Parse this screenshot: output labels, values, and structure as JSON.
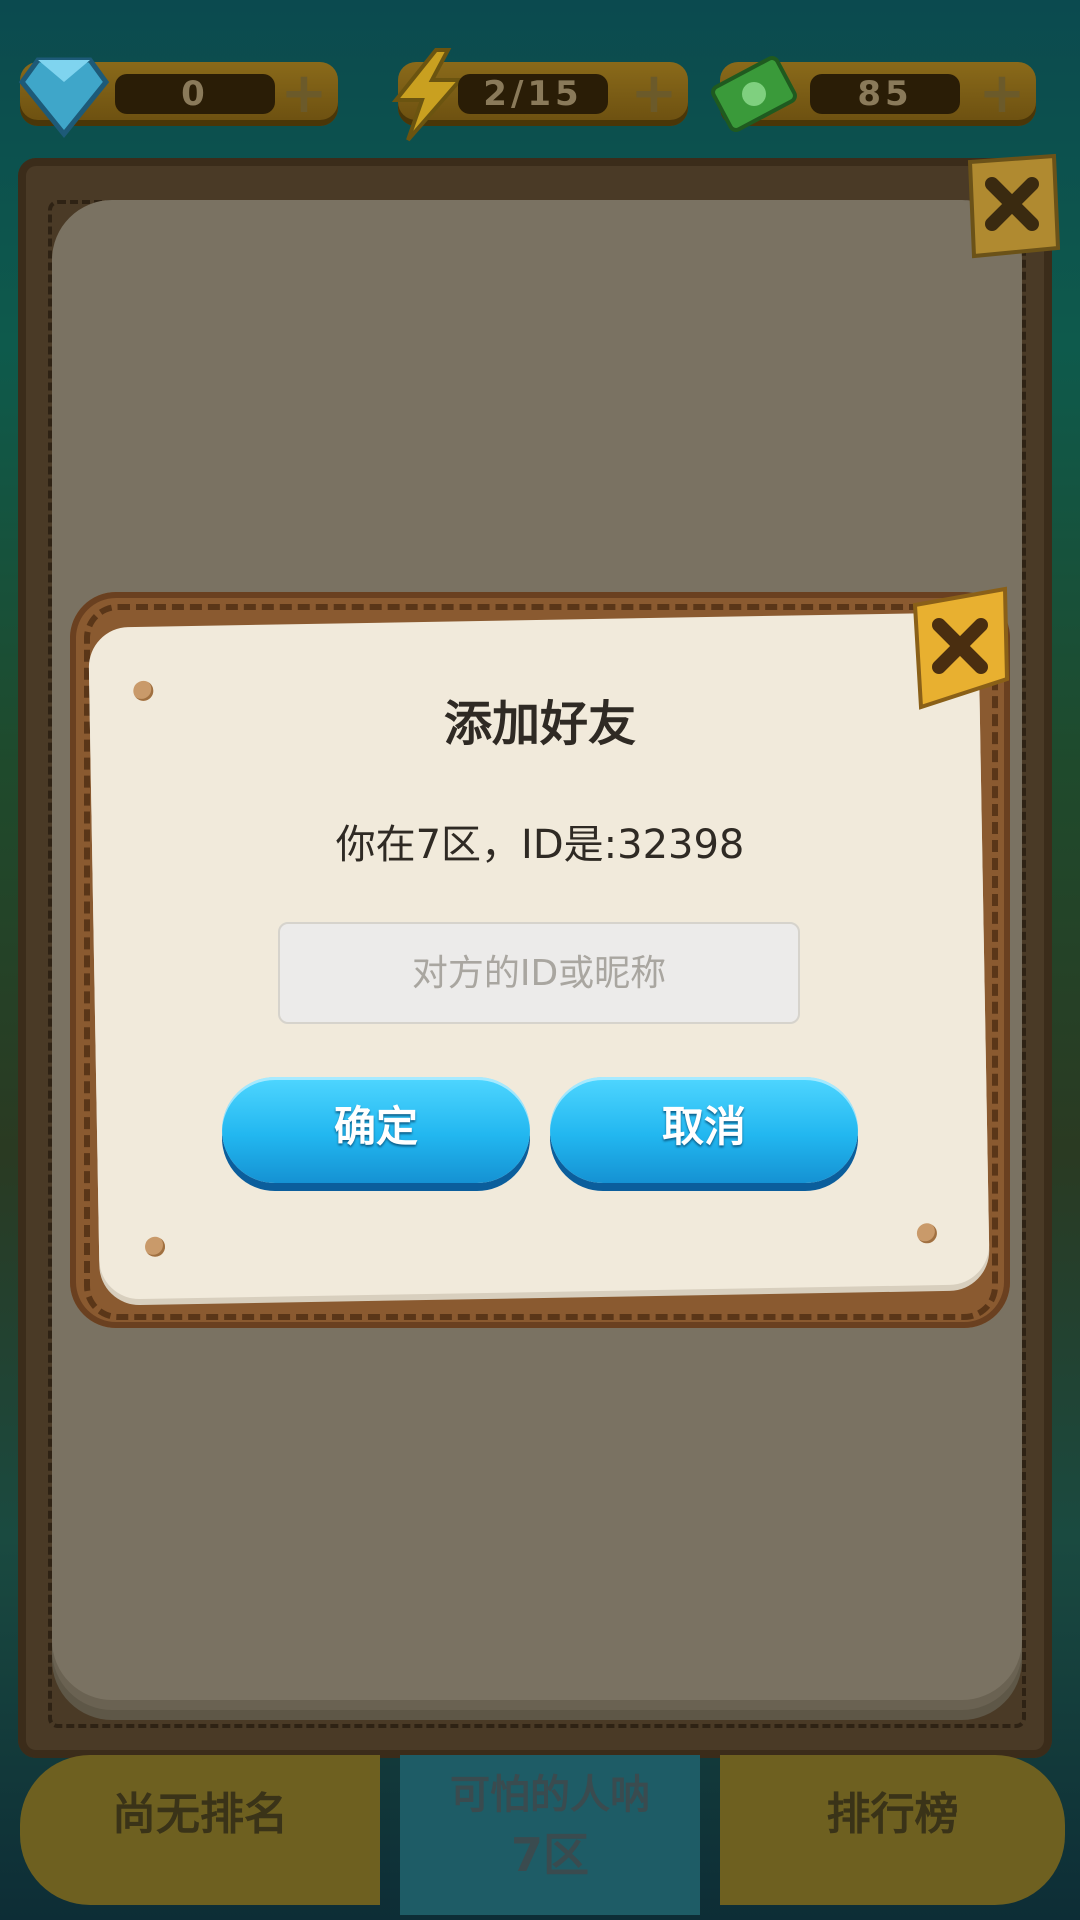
{
  "resources": {
    "diamonds": "0",
    "energy": "2/15",
    "cash": "85"
  },
  "dialog": {
    "title": "添加好友",
    "id_info": "你在7区，ID是:32398",
    "input_placeholder": "对方的ID或昵称",
    "confirm_label": "确定",
    "cancel_label": "取消"
  },
  "bottom": {
    "rank_label": "尚无排名",
    "player_name": "可怕的人呐",
    "zone": "7区",
    "leaderboard_label": "排行榜"
  },
  "icons": [
    "diamond-icon",
    "lightning-icon",
    "cash-icon",
    "plus-icon",
    "close-icon"
  ],
  "colors": {
    "button_blue": "#22b7f0",
    "paper": "#f1eadb",
    "frame": "#8a5a30"
  }
}
